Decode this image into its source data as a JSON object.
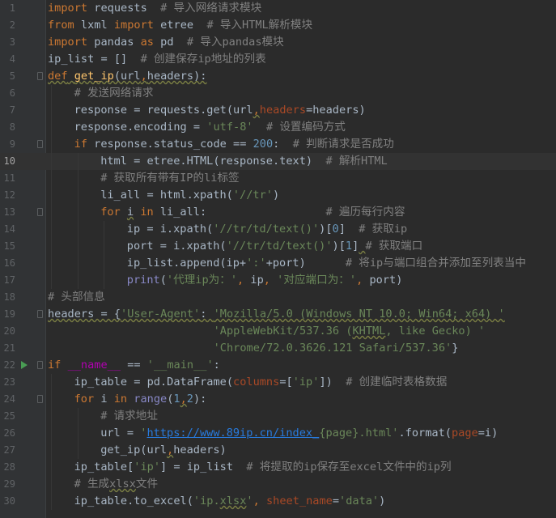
{
  "editor": {
    "current_line": 10,
    "run_marker_line": 22,
    "theme_colors": {
      "background": "#2b2b2b",
      "keyword": "#cc7832",
      "string": "#6a8759",
      "comment": "#808080",
      "number": "#6897bb",
      "function": "#ffc66d"
    }
  },
  "lines": [
    {
      "n": "1",
      "indent": 0,
      "tokens": [
        [
          "kw",
          "import"
        ],
        [
          "plain",
          " requests  "
        ],
        [
          "cmt",
          "# 导入网络请求模块"
        ]
      ]
    },
    {
      "n": "2",
      "indent": 0,
      "tokens": [
        [
          "kw",
          "from"
        ],
        [
          "plain",
          " lxml "
        ],
        [
          "kw",
          "import"
        ],
        [
          "plain",
          " etree  "
        ],
        [
          "cmt",
          "# 导入HTML解析模块"
        ]
      ]
    },
    {
      "n": "3",
      "indent": 0,
      "tokens": [
        [
          "kw",
          "import"
        ],
        [
          "plain",
          " pandas "
        ],
        [
          "kw",
          "as"
        ],
        [
          "plain",
          " pd  "
        ],
        [
          "cmt",
          "# 导入pandas模块"
        ]
      ]
    },
    {
      "n": "4",
      "indent": 0,
      "tokens": [
        [
          "plain",
          "ip_list = []  "
        ],
        [
          "cmt",
          "# 创建保存ip地址的列表"
        ]
      ]
    },
    {
      "n": "5",
      "indent": 0,
      "fold": true,
      "tokens": [
        [
          "kw wavy",
          "def"
        ],
        [
          "plain wavy",
          " "
        ],
        [
          "fn wavy",
          "get_ip"
        ],
        [
          "plain wavy",
          "(url"
        ],
        [
          "kw wavy",
          ","
        ],
        [
          "plain wavy",
          "headers):"
        ]
      ]
    },
    {
      "n": "6",
      "indent": 1,
      "tokens": [
        [
          "cmt",
          "# 发送网络请求"
        ]
      ]
    },
    {
      "n": "7",
      "indent": 1,
      "tokens": [
        [
          "plain",
          "response = requests.get(url"
        ],
        [
          "kw wavy",
          ","
        ],
        [
          "param",
          "headers"
        ],
        [
          "plain",
          "=headers)"
        ]
      ]
    },
    {
      "n": "8",
      "indent": 1,
      "tokens": [
        [
          "plain",
          "response.encoding = "
        ],
        [
          "str",
          "'utf-8'"
        ],
        [
          "plain",
          "  "
        ],
        [
          "cmt",
          "# 设置编码方式"
        ]
      ]
    },
    {
      "n": "9",
      "indent": 1,
      "fold": true,
      "tokens": [
        [
          "kw",
          "if"
        ],
        [
          "plain",
          " response.status_code == "
        ],
        [
          "num",
          "200"
        ],
        [
          "plain",
          ":  "
        ],
        [
          "cmt",
          "# 判断请求是否成功"
        ]
      ]
    },
    {
      "n": "10",
      "indent": 2,
      "tokens": [
        [
          "plain",
          "html = etree.HTML(response.text)  "
        ],
        [
          "cmt",
          "# 解析HTML"
        ]
      ]
    },
    {
      "n": "11",
      "indent": 2,
      "tokens": [
        [
          "cmt",
          "# 获取所有带有IP的li标签"
        ]
      ]
    },
    {
      "n": "12",
      "indent": 2,
      "tokens": [
        [
          "plain",
          "li_all = html.xpath("
        ],
        [
          "str",
          "'//tr'"
        ],
        [
          "plain",
          ")"
        ]
      ]
    },
    {
      "n": "13",
      "indent": 2,
      "fold": true,
      "tokens": [
        [
          "kw",
          "for"
        ],
        [
          "plain",
          " "
        ],
        [
          "plain wavy",
          "i"
        ],
        [
          "plain",
          " "
        ],
        [
          "kw",
          "in"
        ],
        [
          "plain",
          " li_all:                  "
        ],
        [
          "cmt",
          "# 遍历每行内容"
        ]
      ]
    },
    {
      "n": "14",
      "indent": 3,
      "tokens": [
        [
          "plain",
          "ip = i.xpath("
        ],
        [
          "str",
          "'//tr/td/text()'"
        ],
        [
          "plain",
          ")["
        ],
        [
          "num",
          "0"
        ],
        [
          "plain",
          "]  "
        ],
        [
          "cmt",
          "# 获取ip"
        ]
      ]
    },
    {
      "n": "15",
      "indent": 3,
      "tokens": [
        [
          "plain",
          "port = i.xpath("
        ],
        [
          "str",
          "'//tr/td/text()'"
        ],
        [
          "plain",
          ")["
        ],
        [
          "num",
          "1"
        ],
        [
          "plain",
          "]"
        ],
        [
          "plain wavy",
          " "
        ],
        [
          "cmt",
          "# 获取端口"
        ]
      ]
    },
    {
      "n": "16",
      "indent": 3,
      "tokens": [
        [
          "plain",
          "ip_list.append(ip+"
        ],
        [
          "str",
          "':'"
        ],
        [
          "plain",
          "+port)      "
        ],
        [
          "cmt",
          "# 将ip与端口组合并添加至列表当中"
        ]
      ]
    },
    {
      "n": "17",
      "indent": 3,
      "tokens": [
        [
          "builtin",
          "print"
        ],
        [
          "plain",
          "("
        ],
        [
          "str",
          "'代理ip为：'"
        ],
        [
          "kw",
          ","
        ],
        [
          "plain",
          " ip"
        ],
        [
          "kw",
          ","
        ],
        [
          "plain",
          " "
        ],
        [
          "str",
          "'对应端口为：'"
        ],
        [
          "kw",
          ","
        ],
        [
          "plain",
          " port)"
        ]
      ]
    },
    {
      "n": "18",
      "indent": 0,
      "tokens": [
        [
          "cmt",
          "# 头部信息"
        ]
      ]
    },
    {
      "n": "19",
      "indent": 0,
      "fold": true,
      "tokens": [
        [
          "plain wavy",
          "headers = {"
        ],
        [
          "str wavy",
          "'User-Agent'"
        ],
        [
          "plain wavy",
          ": "
        ],
        [
          "str wavy",
          "'Mozilla/5.0 (Windows NT 10.0; Win64; x64) '"
        ]
      ]
    },
    {
      "n": "20",
      "indent": 0,
      "tokens": [
        [
          "plain",
          "                         "
        ],
        [
          "str",
          "'AppleWebKit/537.36 ("
        ],
        [
          "str wavy",
          "KHTML"
        ],
        [
          "str",
          ", like Gecko) '"
        ]
      ]
    },
    {
      "n": "21",
      "indent": 0,
      "tokens": [
        [
          "plain",
          "                         "
        ],
        [
          "str",
          "'Chrome/72.0.3626.121 Safari/537.36'"
        ],
        [
          "plain",
          "}"
        ]
      ]
    },
    {
      "n": "22",
      "indent": 0,
      "fold": true,
      "tokens": [
        [
          "kw",
          "if"
        ],
        [
          "plain",
          " "
        ],
        [
          "dunder",
          "__name__"
        ],
        [
          "plain",
          " == "
        ],
        [
          "str",
          "'__main__'"
        ],
        [
          "plain",
          ":"
        ]
      ]
    },
    {
      "n": "23",
      "indent": 1,
      "tokens": [
        [
          "plain",
          "ip_table = pd.DataFrame("
        ],
        [
          "param",
          "columns"
        ],
        [
          "plain",
          "=["
        ],
        [
          "str",
          "'ip'"
        ],
        [
          "plain",
          "])  "
        ],
        [
          "cmt",
          "# 创建临时表格数据"
        ]
      ]
    },
    {
      "n": "24",
      "indent": 1,
      "fold": true,
      "tokens": [
        [
          "kw",
          "for"
        ],
        [
          "plain",
          " i "
        ],
        [
          "kw",
          "in"
        ],
        [
          "plain",
          " "
        ],
        [
          "builtin",
          "range"
        ],
        [
          "plain",
          "("
        ],
        [
          "num",
          "1"
        ],
        [
          "kw wavy",
          ","
        ],
        [
          "num",
          "2"
        ],
        [
          "plain",
          "):"
        ]
      ]
    },
    {
      "n": "25",
      "indent": 2,
      "tokens": [
        [
          "cmt",
          "# 请求地址"
        ]
      ]
    },
    {
      "n": "26",
      "indent": 2,
      "tokens": [
        [
          "plain",
          "url = "
        ],
        [
          "str",
          "'"
        ],
        [
          "link",
          "https://www.89ip.cn/index_"
        ],
        [
          "str",
          "{page}.html'"
        ],
        [
          "plain",
          ".format("
        ],
        [
          "param",
          "page"
        ],
        [
          "plain",
          "=i)"
        ]
      ]
    },
    {
      "n": "27",
      "indent": 2,
      "tokens": [
        [
          "plain",
          "get_ip(url"
        ],
        [
          "kw wavy",
          ","
        ],
        [
          "plain",
          "headers)"
        ]
      ]
    },
    {
      "n": "28",
      "indent": 1,
      "tokens": [
        [
          "plain",
          "ip_table["
        ],
        [
          "str",
          "'ip'"
        ],
        [
          "plain",
          "] = ip_list  "
        ],
        [
          "cmt",
          "# 将提取的ip保存至excel文件中的ip列"
        ]
      ]
    },
    {
      "n": "29",
      "indent": 1,
      "tokens": [
        [
          "cmt",
          "# 生成"
        ],
        [
          "cmt wavy",
          "xlsx"
        ],
        [
          "cmt",
          "文件"
        ]
      ]
    },
    {
      "n": "30",
      "indent": 1,
      "tokens": [
        [
          "plain",
          "ip_table.to_excel("
        ],
        [
          "str",
          "'ip."
        ],
        [
          "str wavy",
          "xlsx"
        ],
        [
          "str",
          "'"
        ],
        [
          "kw",
          ","
        ],
        [
          "plain",
          " "
        ],
        [
          "param",
          "sheet_name"
        ],
        [
          "plain",
          "="
        ],
        [
          "str",
          "'data'"
        ],
        [
          "plain",
          ")"
        ]
      ]
    }
  ]
}
